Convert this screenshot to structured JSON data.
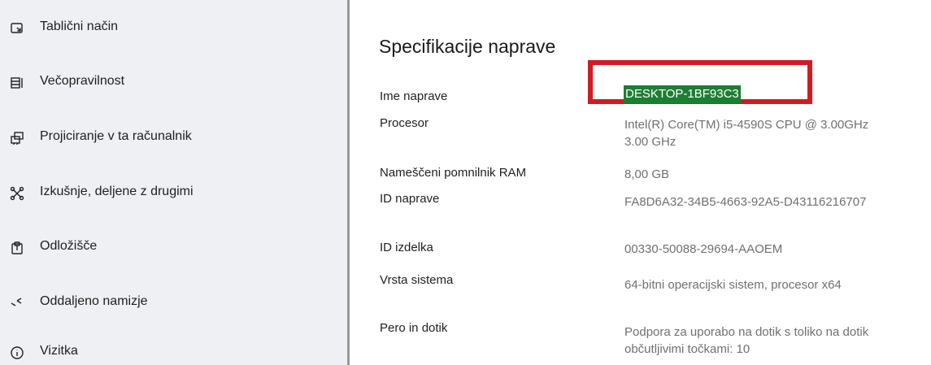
{
  "sidebar": {
    "items": [
      {
        "label": "Tablični način",
        "icon": "tablet-mode-icon"
      },
      {
        "label": "Večopravilnost",
        "icon": "multitasking-icon"
      },
      {
        "label": "Projiciranje v ta računalnik",
        "icon": "projecting-icon"
      },
      {
        "label": "Izkušnje, deljene z drugimi",
        "icon": "shared-experiences-icon"
      },
      {
        "label": "Odložišče",
        "icon": "clipboard-icon"
      },
      {
        "label": "Oddaljeno namizje",
        "icon": "remote-desktop-icon"
      },
      {
        "label": "Vizitka",
        "icon": "info-icon"
      }
    ]
  },
  "main": {
    "title": "Specifikacije naprave",
    "specs": [
      {
        "label": "Ime naprave",
        "value": "DESKTOP-1BF93C3"
      },
      {
        "label": "Procesor",
        "value": "Intel(R) Core(TM) i5-4590S CPU @ 3.00GHz   3.00 GHz"
      },
      {
        "label": "Nameščeni pomnilnik RAM",
        "value": "8,00 GB"
      },
      {
        "label": "ID naprave",
        "value": "FA8D6A32-34B5-4663-92A5-D43116216707"
      },
      {
        "label": "ID izdelka",
        "value": "00330-50088-29694-AAOEM"
      },
      {
        "label": "Vrsta sistema",
        "value": "64-bitni operacijski sistem, procesor x64"
      },
      {
        "label": "Pero in dotik",
        "value": "Podpora za uporabo na dotik s toliko na dotik občutljivimi točkami: 10"
      }
    ]
  },
  "colors": {
    "sidebar_bg": "#eef0f3",
    "highlight_border": "#d11b22",
    "selection_bg": "#1e7d32",
    "value_text": "#707070"
  }
}
